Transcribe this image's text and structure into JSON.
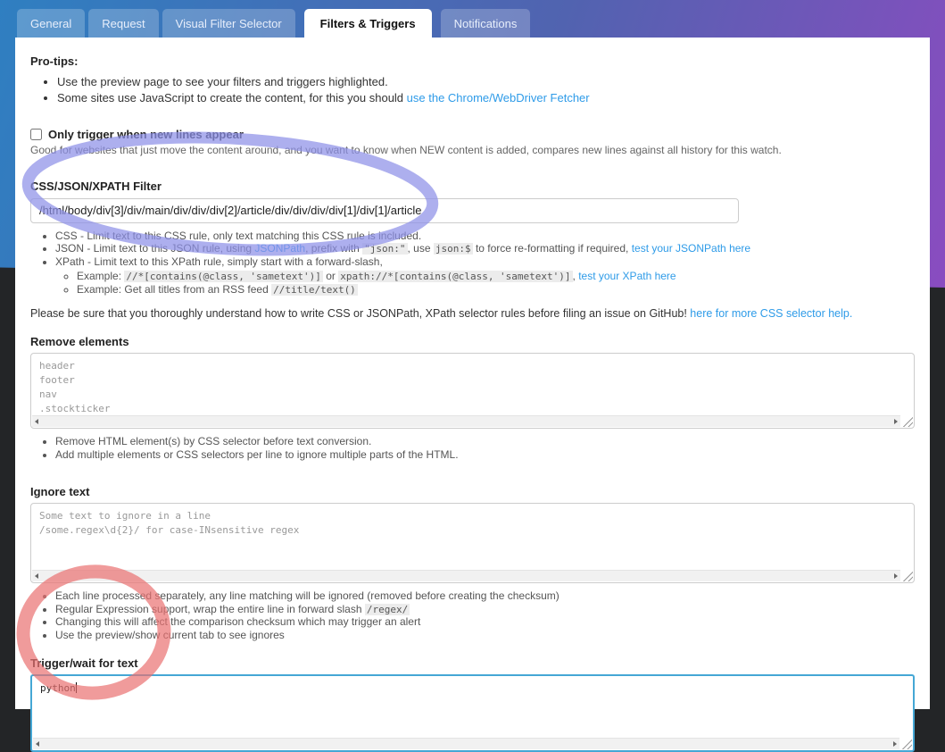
{
  "colors": {
    "link": "#2e9be8",
    "annotation_blue": "#8d90e8",
    "annotation_red": "#ea7070",
    "focus_border": "#45a7d5",
    "header_gradient_left": "#2f7fc1",
    "header_gradient_right": "#8a4cc0"
  },
  "tabs": [
    {
      "label": "General"
    },
    {
      "label": "Request"
    },
    {
      "label": "Visual Filter Selector"
    },
    {
      "label": "Filters & Triggers"
    },
    {
      "label": "Notifications"
    }
  ],
  "protips": {
    "title": "Pro-tips:",
    "item1": "Use the preview page to see your filters and triggers highlighted.",
    "item2_text": "Some sites use JavaScript to create the content, for this you should ",
    "item2_link": "use the Chrome/WebDriver Fetcher"
  },
  "new_lines": {
    "label": "Only trigger when new lines appear",
    "help": "Good for websites that just move the content around, and you want to know when NEW content is added, compares new lines against all history for this watch."
  },
  "css_filter": {
    "label": "CSS/JSON/XPATH Filter",
    "value": "/html/body/div[3]/div/main/div/div/div[2]/article/div/div/div/div[1]/div[1]/article",
    "note_css": "CSS - Limit text to this CSS rule, only text matching this CSS rule is included.",
    "note_json": {
      "t1": "JSON - Limit text to this JSON rule, using ",
      "link1": "JSONPath",
      "t2": ", prefix with ",
      "code1": "\"json:\"",
      "t3": ", use ",
      "code2": "json:$",
      "t4": " to force re-formatting if required, ",
      "link2": "test your JSONPath here"
    },
    "note_xpath": "XPath - Limit text to this XPath rule, simply start with a forward-slash,",
    "example1": {
      "t1": "Example: ",
      "code1": "//*[contains(@class, 'sametext')]",
      "t2": " or ",
      "code2": "xpath://*[contains(@class, 'sametext')]",
      "t3": ", ",
      "link": "test your XPath here"
    },
    "example2": {
      "t1": "Example: Get all titles from an RSS feed ",
      "code": "//title/text()"
    },
    "github_note": "Please be sure that you thoroughly understand how to write CSS or JSONPath, XPath selector rules before filing an issue on GitHub! ",
    "github_link": "here for more CSS selector help."
  },
  "remove_elements": {
    "label": "Remove elements",
    "placeholder": "header\nfooter\nnav\n.stockticker",
    "note1": "Remove HTML element(s) by CSS selector before text conversion.",
    "note2": "Add multiple elements or CSS selectors per line to ignore multiple parts of the HTML."
  },
  "ignore_text": {
    "label": "Ignore text",
    "placeholder": "Some text to ignore in a line\n/some.regex\\d{2}/ for case-INsensitive regex",
    "note1": "Each line processed separately, any line matching will be ignored (removed before creating the checksum)",
    "note2_text": "Regular Expression support, wrap the entire line in forward slash ",
    "note2_code": "/regex/",
    "note3": "Changing this will affect the comparison checksum which may trigger an alert",
    "note4": "Use the preview/show current tab to see ignores"
  },
  "trigger_text": {
    "label": "Trigger/wait for text",
    "value": "python"
  }
}
